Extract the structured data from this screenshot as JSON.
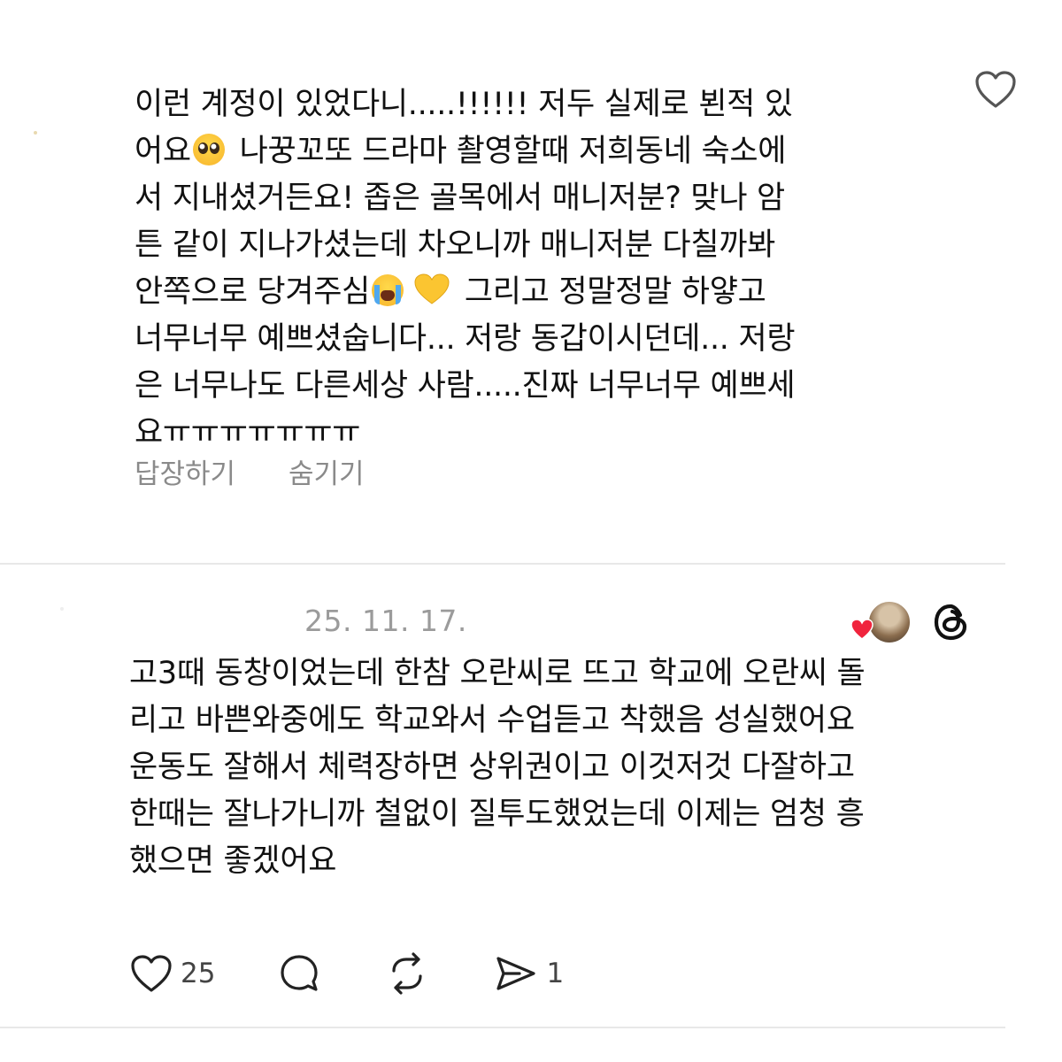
{
  "reply": {
    "lines": [
      "이런 계정이 있었다니.....!!!!!! 저두 실제로 뵌적 있",
      "나꿍꼬또 드라마 촬영할때 저희동네 숙소에",
      "서 지내셨거든요! 좁은 골목에서 매니저분? 맞나 암",
      "튼  같이 지나가셨는데 차오니까 매니저분 다칠까봐",
      "그리고 정말정말 하얗고",
      "너무너무 예쁘셨숩니다... 저랑 동갑이시던데... 저랑",
      "은 너무나도 다른세상 사람.....진짜 너무너무 예쁘세",
      "요ㅠㅠㅠㅠㅠㅠㅠ"
    ],
    "line2_prefix": "어요",
    "line5_prefix": "안쪽으로 당겨주심",
    "emoji_pleading": "pleading-face-emoji",
    "emoji_crying": "loudly-crying-face-emoji",
    "emoji_heart": "yellow-heart-emoji",
    "reply_label": "답장하기",
    "hide_label": "숨기기",
    "like_icon": "heart-outline-icon"
  },
  "post": {
    "date": "25. 11. 17.",
    "lines": [
      "고3때 동창이었는데 한참 오란씨로 뜨고 학교에 오란씨 돌",
      "리고 바쁜와중에도 학교와서 수업듣고 착했음 성실했어요",
      "운동도 잘해서 체력장하면 상위권이고 이것저것 다잘하고",
      "한때는 잘나가니까 철없이 질투도했었는데 이제는 엄청 흥",
      "했으면 좋겠어요"
    ],
    "like_count": "25",
    "share_count": "1",
    "icons": {
      "like": "heart-icon",
      "comment": "comment-bubble-icon",
      "repost": "repost-icon",
      "share": "send-icon",
      "brand": "threads-logo-icon",
      "liked_by": "liked-by-avatar"
    },
    "colors": {
      "liked_heart": "#f0243d",
      "meta_gray": "#9b9b9b"
    }
  }
}
